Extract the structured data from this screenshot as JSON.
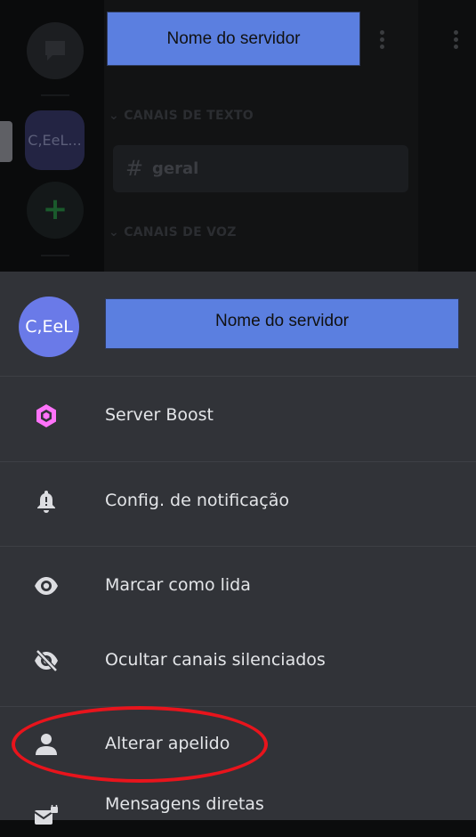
{
  "background": {
    "server_name_placeholder": "Nome do servidor",
    "guild_server_abbrev": "C,EeL...",
    "categories": [
      {
        "label": "CANAIS DE TEXTO",
        "chevron": "⌄"
      },
      {
        "label": "CANAIS DE VOZ",
        "chevron": "⌄"
      }
    ],
    "channel": {
      "hash": "#",
      "name": "geral"
    },
    "add_server_symbol": "+"
  },
  "sheet": {
    "avatar_text": "C,EeL",
    "server_name_placeholder": "Nome do servidor",
    "items": [
      {
        "label": "Server Boost",
        "icon": "boost-gem-icon"
      },
      {
        "label": "Config. de notificação",
        "icon": "bell-icon"
      },
      {
        "label": "Marcar como lida",
        "icon": "eye-icon"
      },
      {
        "label": "Ocultar canais silenciados",
        "icon": "eye-slash-icon"
      },
      {
        "label": "Alterar apelido",
        "icon": "person-icon"
      },
      {
        "label": "Mensagens diretas",
        "icon": "envelope-lock-icon"
      }
    ]
  },
  "colors": {
    "sheet_bg": "#313338",
    "boost_pink": "#ff73fa",
    "placeholder_blue": "#5b7fe0",
    "highlight_red": "#e8141c",
    "avatar": "#6a7ae8"
  }
}
